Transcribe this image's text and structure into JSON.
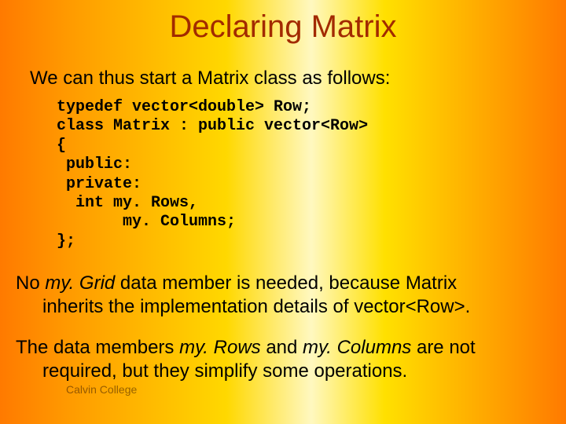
{
  "title": "Declaring Matrix",
  "intro": "We can thus start a Matrix class as follows:",
  "code": "typedef vector<double> Row;\nclass Matrix : public vector<Row>\n{\n public:\n private:\n  int my. Rows,\n       my. Columns;\n};",
  "para1_a": "No ",
  "para1_ital": "my. Grid",
  "para1_b": " data member is needed, because Matrix",
  "para1_cont": "inherits the implementation details of vector<Row>.",
  "para2_a": "The data members ",
  "para2_ital1": "my. Rows",
  "para2_mid": " and ",
  "para2_ital2": "my. Columns",
  "para2_b": " are not",
  "para2_cont": "required, but they simplify some operations.",
  "footer": "Calvin College"
}
